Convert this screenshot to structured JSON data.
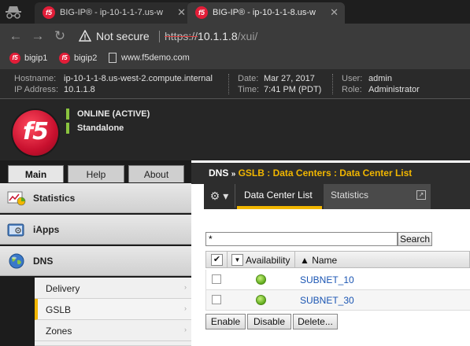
{
  "browser": {
    "tabs": [
      {
        "title": "BIG-IP® - ip-10-1-1-7.us-w",
        "favicon": "f5"
      },
      {
        "title": "BIG-IP® - ip-10-1-1-8.us-w",
        "favicon": "f5"
      }
    ],
    "close_glyph": "✕",
    "nav": {
      "back": "←",
      "forward": "→",
      "reload": "↻"
    },
    "security_label": "Not secure",
    "url_scheme": "https://",
    "url_host": "10.1.1.8",
    "url_path": "/xui/",
    "bookmarks": [
      {
        "label": "bigip1",
        "icon": "f5"
      },
      {
        "label": "bigip2",
        "icon": "f5"
      },
      {
        "label": "www.f5demo.com",
        "icon": "page-icon"
      }
    ]
  },
  "banner": {
    "hostname_key": "Hostname:",
    "hostname": "ip-10-1-1-8.us-west-2.compute.internal",
    "ip_key": "IP Address:",
    "ip": "10.1.1.8",
    "date_key": "Date:",
    "date": "Mar 27, 2017",
    "time_key": "Time:",
    "time": "7:41 PM (PDT)",
    "user_key": "User:",
    "user": "admin",
    "role_key": "Role:",
    "role": "Administrator"
  },
  "header": {
    "logo_text": "f5",
    "status": "ONLINE (ACTIVE)",
    "mode": "Standalone",
    "status_color": "#8ac43f"
  },
  "leftnav": {
    "tabs": [
      {
        "label": "Main",
        "active": true
      },
      {
        "label": "Help",
        "active": false
      },
      {
        "label": "About",
        "active": false
      }
    ],
    "sections": [
      {
        "label": "Statistics",
        "icon": "statistics-icon"
      },
      {
        "label": "iApps",
        "icon": "iapps-icon"
      },
      {
        "label": "DNS",
        "icon": "globe-icon"
      }
    ],
    "dns_items": [
      {
        "label": "Delivery",
        "selected": false
      },
      {
        "label": "GSLB",
        "selected": true
      },
      {
        "label": "Zones",
        "selected": false
      }
    ],
    "item_arrow": "›",
    "accent": "#f1b600"
  },
  "content": {
    "crumb_root": "DNS",
    "crumb_sep": "»",
    "crumb_path": "GSLB : Data Centers : Data Center List",
    "gear_glyph": "⚙ ▾",
    "tabs": [
      {
        "label": "Data Center List",
        "active": true
      },
      {
        "label": "Statistics",
        "active": false
      }
    ],
    "ext_glyph": "↗",
    "search_value": "*",
    "search_button": "Search",
    "columns": {
      "check_glyph": "✔",
      "dropdown_glyph": "▼",
      "availability": "Availability",
      "name": "▲ Name"
    },
    "rows": [
      {
        "name": "SUBNET_10",
        "status": "available"
      },
      {
        "name": "SUBNET_30",
        "status": "available"
      }
    ],
    "actions": [
      "Enable",
      "Disable",
      "Delete..."
    ]
  }
}
